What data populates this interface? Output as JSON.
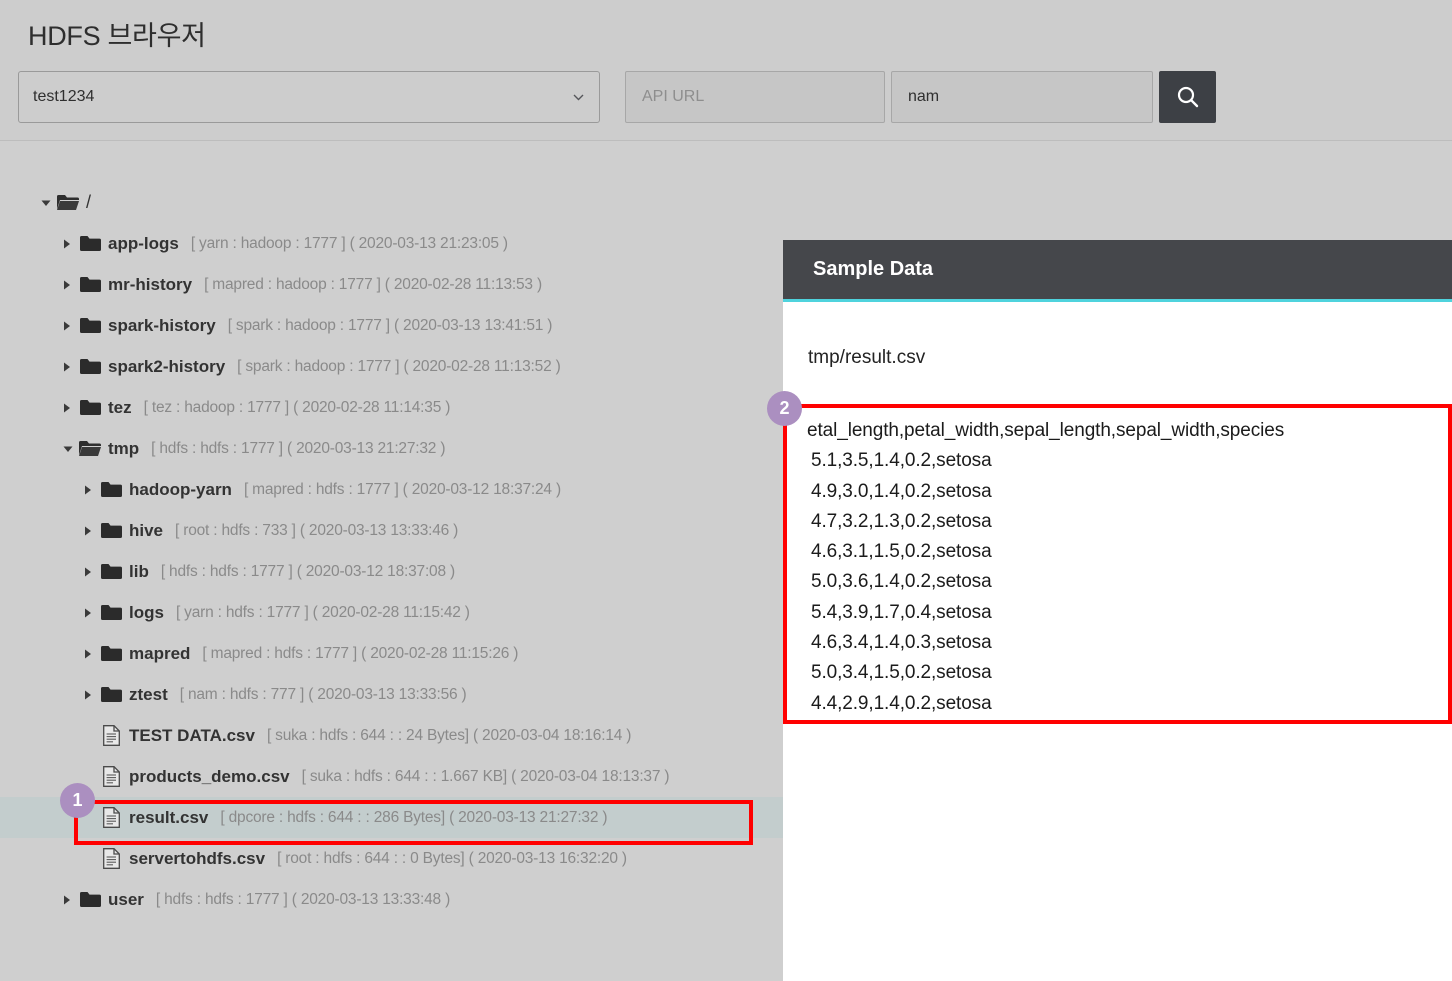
{
  "header": {
    "title": "HDFS 브라우저",
    "connection_select": {
      "value": "test1234",
      "icon": "chevron-down-icon"
    },
    "api_url_field": {
      "value": "",
      "placeholder": "API URL"
    },
    "search_field": {
      "value": "nam",
      "placeholder": ""
    },
    "search_button": {
      "icon": "search-icon",
      "label": ""
    }
  },
  "tree": {
    "root": {
      "name": "/",
      "icon": "folder-open-icon",
      "expanded": true
    },
    "items": [
      {
        "name": "app-logs",
        "meta": "[ yarn : hadoop : 1777 ] ( 2020-03-13 21:23:05 )",
        "type": "folder",
        "depth": 1,
        "expanded": false,
        "selected": false
      },
      {
        "name": "mr-history",
        "meta": "[ mapred : hadoop : 1777 ] ( 2020-02-28 11:13:53 )",
        "type": "folder",
        "depth": 1,
        "expanded": false,
        "selected": false
      },
      {
        "name": "spark-history",
        "meta": "[ spark : hadoop : 1777 ] ( 2020-03-13 13:41:51 )",
        "type": "folder",
        "depth": 1,
        "expanded": false,
        "selected": false
      },
      {
        "name": "spark2-history",
        "meta": "[ spark : hadoop : 1777 ] ( 2020-02-28 11:13:52 )",
        "type": "folder",
        "depth": 1,
        "expanded": false,
        "selected": false
      },
      {
        "name": "tez",
        "meta": "[ tez : hadoop : 1777 ] ( 2020-02-28 11:14:35 )",
        "type": "folder",
        "depth": 1,
        "expanded": false,
        "selected": false
      },
      {
        "name": "tmp",
        "meta": "[ hdfs : hdfs : 1777 ] ( 2020-03-13 21:27:32 )",
        "type": "folder-open",
        "depth": 1,
        "expanded": true,
        "selected": false
      },
      {
        "name": "hadoop-yarn",
        "meta": "[ mapred : hdfs : 1777 ] ( 2020-03-12 18:37:24 )",
        "type": "folder",
        "depth": 2,
        "expanded": false,
        "selected": false
      },
      {
        "name": "hive",
        "meta": "[ root : hdfs : 733 ] ( 2020-03-13 13:33:46 )",
        "type": "folder",
        "depth": 2,
        "expanded": false,
        "selected": false
      },
      {
        "name": "lib",
        "meta": "[ hdfs : hdfs : 1777 ] ( 2020-03-12 18:37:08 )",
        "type": "folder",
        "depth": 2,
        "expanded": false,
        "selected": false
      },
      {
        "name": "logs",
        "meta": "[ yarn : hdfs : 1777 ] ( 2020-02-28 11:15:42 )",
        "type": "folder",
        "depth": 2,
        "expanded": false,
        "selected": false
      },
      {
        "name": "mapred",
        "meta": "[ mapred : hdfs : 1777 ] ( 2020-02-28 11:15:26 )",
        "type": "folder",
        "depth": 2,
        "expanded": false,
        "selected": false
      },
      {
        "name": "ztest",
        "meta": "[ nam : hdfs : 777 ] ( 2020-03-13 13:33:56 )",
        "type": "folder",
        "depth": 2,
        "expanded": false,
        "selected": false
      },
      {
        "name": "TEST DATA.csv",
        "meta": "[ suka : hdfs : 644 : : 24 Bytes] ( 2020-03-04 18:16:14 )",
        "type": "file",
        "depth": 2,
        "expanded": false,
        "selected": false
      },
      {
        "name": "products_demo.csv",
        "meta": "[ suka : hdfs : 644 : : 1.667 KB] ( 2020-03-04 18:13:37 )",
        "type": "file",
        "depth": 2,
        "expanded": false,
        "selected": false
      },
      {
        "name": "result.csv",
        "meta": "[ dpcore : hdfs : 644 : : 286 Bytes] ( 2020-03-13 21:27:32 )",
        "type": "file",
        "depth": 2,
        "expanded": false,
        "selected": true
      },
      {
        "name": "servertohdfs.csv",
        "meta": "[ root : hdfs : 644 : : 0 Bytes] ( 2020-03-13 16:32:20 )",
        "type": "file",
        "depth": 2,
        "expanded": false,
        "selected": false
      },
      {
        "name": "user",
        "meta": "[ hdfs : hdfs : 1777 ] ( 2020-03-13 13:33:48 )",
        "type": "folder",
        "depth": 1,
        "expanded": false,
        "selected": false
      }
    ]
  },
  "sample_panel": {
    "title": "Sample Data",
    "file_path": "tmp/result.csv",
    "csv_lines": [
      "etal_length,petal_width,sepal_length,sepal_width,species",
      "5.1,3.5,1.4,0.2,setosa",
      "4.9,3.0,1.4,0.2,setosa",
      "4.7,3.2,1.3,0.2,setosa",
      "4.6,3.1,1.5,0.2,setosa",
      "5.0,3.6,1.4,0.2,setosa",
      "5.4,3.9,1.7,0.4,setosa",
      "4.6,3.4,1.4,0.3,setosa",
      "5.0,3.4,1.5,0.2,setosa",
      "4.4,2.9,1.4,0.2,setosa"
    ]
  },
  "annotations": {
    "badges": [
      {
        "label": "1",
        "target": "result-csv-row"
      },
      {
        "label": "2",
        "target": "csv-preview-area"
      }
    ],
    "highlight_color": "#ff0000",
    "badge_color": "#ab8fc0"
  },
  "colors": {
    "page_background": "#cfcfcf",
    "header_background": "#cdcdcd",
    "panel_header": "#45474b",
    "panel_accent": "#4fd3dd",
    "selected_row": "#c3cdcd",
    "search_button": "#3d4045"
  }
}
